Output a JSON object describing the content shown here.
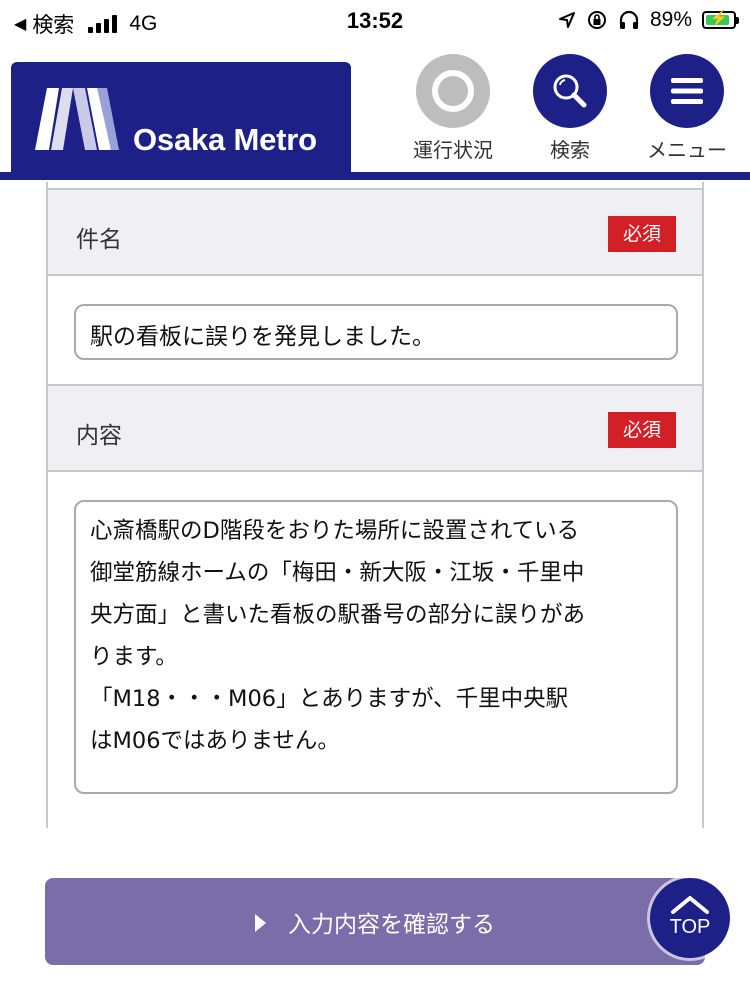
{
  "status_bar": {
    "back_label": "検索",
    "network": "4G",
    "time": "13:52",
    "battery_percent": "89%",
    "battery_level": 0.89
  },
  "header": {
    "brand_name": "Osaka Metro",
    "nav": {
      "status_label": "運行状況",
      "search_label": "検索",
      "menu_label": "メニュー"
    },
    "colors": {
      "brand": "#1d2087",
      "status_icon": "#bdbdbd"
    }
  },
  "form": {
    "subject": {
      "label": "件名",
      "required_badge": "必須",
      "value": "駅の看板に誤りを発見しました。"
    },
    "content": {
      "label": "内容",
      "required_badge": "必須",
      "lines": [
        "心斎橋駅のD階段をおりた場所に設置されている",
        "御堂筋線ホームの「梅田・新大阪・江坂・千里中",
        "央方面」と書いた看板の駅番号の部分に誤りがあ",
        "ります。",
        "「M18・・・M06」とありますが、千里中央駅",
        "はM06ではありません。"
      ]
    },
    "required_color": "#d32027"
  },
  "submit": {
    "label": "入力内容を確認する",
    "color": "#7b6daa"
  },
  "top_button": {
    "label": "TOP"
  }
}
